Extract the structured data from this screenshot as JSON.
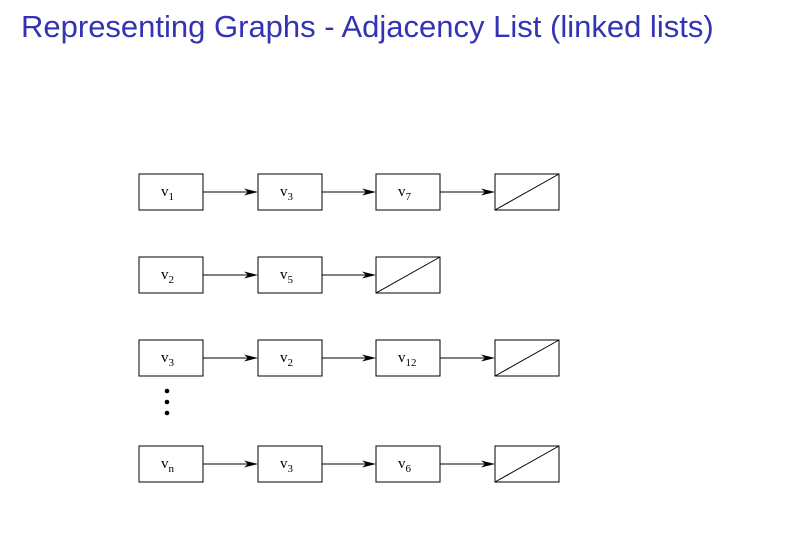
{
  "slide": {
    "title": "Representing Graphs - Adjacency List (linked lists)"
  },
  "adjacency_list": {
    "rows": [
      {
        "head": {
          "base": "v",
          "sub": "1"
        },
        "neighbors": [
          {
            "base": "v",
            "sub": "3"
          },
          {
            "base": "v",
            "sub": "7"
          }
        ]
      },
      {
        "head": {
          "base": "v",
          "sub": "2"
        },
        "neighbors": [
          {
            "base": "v",
            "sub": "5"
          }
        ]
      },
      {
        "head": {
          "base": "v",
          "sub": "3"
        },
        "neighbors": [
          {
            "base": "v",
            "sub": "2"
          },
          {
            "base": "v",
            "sub": "12"
          }
        ]
      },
      {
        "head": {
          "base": "v",
          "sub": "n"
        },
        "neighbors": [
          {
            "base": "v",
            "sub": "3"
          },
          {
            "base": "v",
            "sub": "6"
          }
        ]
      }
    ],
    "ellipsis_after_row": 2,
    "null_terminator": true
  }
}
